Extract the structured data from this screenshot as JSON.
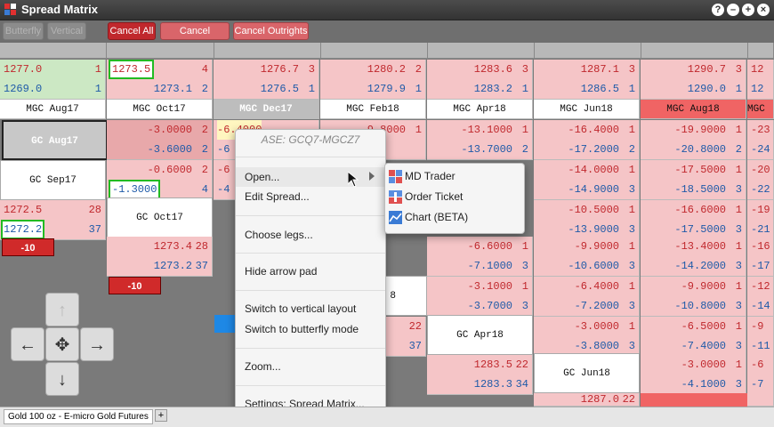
{
  "window": {
    "title": "Spread Matrix",
    "controls": [
      "?",
      "–",
      "+",
      "×"
    ]
  },
  "toolbar": {
    "butterfly": "Butterfly",
    "vertical": "Vertical",
    "cancel_all": "Cancel All",
    "cancel_spreads": "Cancel Spreads",
    "cancel_outrights": "Cancel Outrights"
  },
  "outrights": [
    {
      "name": "MGC Aug17",
      "top": "1277.0",
      "top_q": "1",
      "bot": "1269.0",
      "bot_q": "1"
    },
    {
      "name": "MGC Oct17",
      "top": "1273.5",
      "top_q": "4",
      "bot": "1273.1",
      "bot_q": "2"
    },
    {
      "name": "MGC Dec17",
      "top": "1276.7",
      "top_q": "3",
      "bot": "1276.5",
      "bot_q": "1"
    },
    {
      "name": "MGC Feb18",
      "top": "1280.2",
      "top_q": "2",
      "bot": "1279.9",
      "bot_q": "1"
    },
    {
      "name": "MGC Apr18",
      "top": "1283.6",
      "top_q": "3",
      "bot": "1283.2",
      "bot_q": "1"
    },
    {
      "name": "MGC Jun18",
      "top": "1287.1",
      "top_q": "3",
      "bot": "1286.5",
      "bot_q": "1"
    },
    {
      "name": "MGC Aug18",
      "top": "1290.7",
      "top_q": "3",
      "bot": "1290.0",
      "bot_q": "1"
    },
    {
      "name": "MGC O",
      "top": "12",
      "top_q": "",
      "bot": "12",
      "bot_q": ""
    }
  ],
  "rows": {
    "r0": {
      "label": "GC Aug17",
      "c1t": "-3.0000",
      "c1tq": "2",
      "c1b": "-3.6000",
      "c1bq": "2",
      "c2t": "-6.4000",
      "c2b": "-6",
      "c3t": "-9.8000",
      "c3tq": "1",
      "c3b": "",
      "c4t": "-13.1000",
      "c4tq": "1",
      "c4b": "-13.7000",
      "c4bq": "2",
      "c5t": "-16.4000",
      "c5tq": "1",
      "c5b": "-17.2000",
      "c5bq": "2",
      "c6t": "-19.9000",
      "c6tq": "1",
      "c6b": "-20.8000",
      "c6bq": "2",
      "c7t": "-23",
      "c7b": "-24"
    },
    "r1": {
      "label": "GC Sep17",
      "c1t": "-0.6000",
      "c1tq": "2",
      "c1b": "-1.3000",
      "c1bq": "4",
      "c2t": "-6",
      "c2b": "-4",
      "c5t": "-14.0000",
      "c5tq": "1",
      "c5b": "-14.9000",
      "c5bq": "3",
      "c6t": "-17.5000",
      "c6tq": "1",
      "c6b": "-18.5000",
      "c6bq": "3",
      "c7t": "-20",
      "c7b": "-22"
    },
    "r2": {
      "t": "1272.5",
      "tq": "28",
      "b": "1272.2",
      "bq": "37",
      "neg": "-10",
      "label": "GC Oct17",
      "c5t": "-10.5000",
      "c5tq": "1",
      "c5b": "-13.9000",
      "c5bq": "3",
      "c6t": "-16.6000",
      "c6tq": "1",
      "c6b": "-17.5000",
      "c6bq": "3",
      "c7t": "-19",
      "c7b": "-21"
    },
    "r3": {
      "c1t": "1273.4",
      "c1tq": "28",
      "c1b": "1273.2",
      "c1bq": "37",
      "c4t": "-6.6000",
      "c4tq": "1",
      "c4b": "-7.1000",
      "c4bq": "3",
      "c5t": "-9.9000",
      "c5tq": "1",
      "c5b": "-10.6000",
      "c5bq": "3",
      "c6t": "-13.4000",
      "c6tq": "1",
      "c6b": "-14.2000",
      "c6bq": "3",
      "c7t": "-16",
      "c7b": "-17"
    },
    "r4": {
      "neg": "-10",
      "c4t": "-3.1000",
      "c4tq": "1",
      "c4b": "-3.7000",
      "c4bq": "3",
      "c5t": "-6.4000",
      "c5tq": "1",
      "c5b": "-7.2000",
      "c5bq": "3",
      "c6t": "-9.9000",
      "c6tq": "1",
      "c6b": "-10.8000",
      "c6bq": "3",
      "c7t": "-12",
      "c7b": "-14",
      "c3frag": "8"
    },
    "r5": {
      "c3t": "22",
      "c3b": "37",
      "label": "GC Apr18",
      "c5t": "-3.0000",
      "c5tq": "1",
      "c5b": "-3.8000",
      "c5bq": "3",
      "c6t": "-6.5000",
      "c6tq": "1",
      "c6b": "-7.4000",
      "c6bq": "3",
      "c7t": "-9",
      "c7b": "-11"
    },
    "r6": {
      "c4t": "1283.5",
      "c4tq": "22",
      "c4b": "1283.3",
      "c4bq": "34",
      "label": "GC Jun18",
      "c6t": "-3.0000",
      "c6tq": "1",
      "c6b": "-4.1000",
      "c6bq": "3",
      "c7t": "-6",
      "c7b": "-7"
    },
    "r7": {
      "c5t": "1287.0",
      "c5tq": "22"
    }
  },
  "context_menu": {
    "header": "ASE: GCQ7-MGCZ7",
    "items": [
      "Open...",
      "Edit Spread...",
      "Choose legs...",
      "Hide arrow pad",
      "Switch to vertical layout",
      "Switch to butterfly mode",
      "Zoom...",
      "Settings: Spread Matrix..."
    ]
  },
  "submenu": {
    "items": [
      "MD Trader",
      "Order Ticket",
      "Chart (BETA)"
    ]
  },
  "arrow_pad": {
    "up": "up-arrow-icon",
    "left": "left-arrow-icon",
    "center": "recenter-icon",
    "right": "right-arrow-icon",
    "down": "down-arrow-icon"
  },
  "tabs": {
    "active": "Gold 100 oz - E-micro Gold Futures",
    "add": "+"
  },
  "colors": {
    "bid_red": "#c0282d",
    "ask_blue": "#1e5aa8",
    "cell_pink": "#f5c5c7",
    "highlight_red": "#f06464"
  }
}
